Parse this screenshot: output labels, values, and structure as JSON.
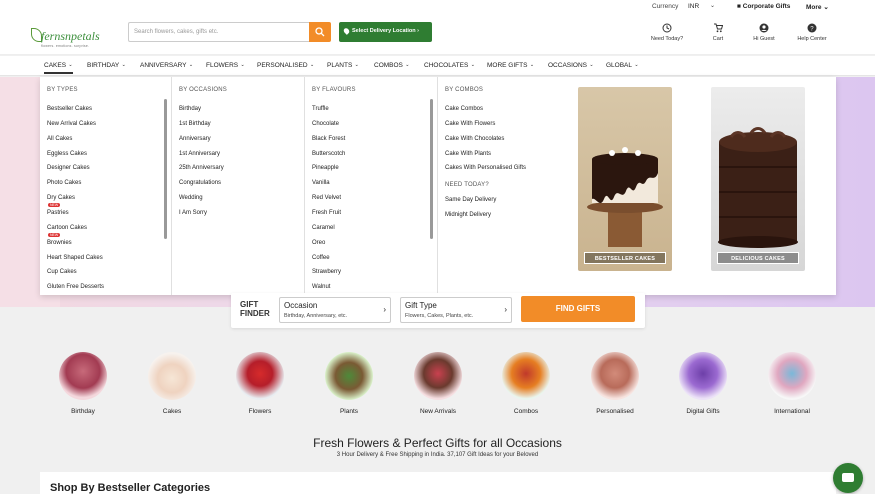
{
  "topbar": {
    "currency_label": "Currency",
    "currency_value": "INR",
    "corporate": "Corporate Gifts",
    "more": "More"
  },
  "header": {
    "logo_name": "fernsnpetals",
    "logo_tagline": "flowers. emotions. surprise.",
    "search_placeholder": "Search flowers, cakes, gifts etc.",
    "delivery_label": "Select Delivery Location",
    "icons": [
      {
        "label": "Need Today?",
        "icon": "clock-icon"
      },
      {
        "label": "Cart",
        "icon": "cart-icon"
      },
      {
        "label": "Hi Guest",
        "icon": "user-icon"
      },
      {
        "label": "Help Center",
        "icon": "help-icon"
      }
    ]
  },
  "nav": {
    "items": [
      "CAKES",
      "BIRTHDAY",
      "ANNIVERSARY",
      "FLOWERS",
      "PERSONALISED",
      "PLANTS",
      "COMBOS",
      "CHOCOLATES",
      "MORE GIFTS",
      "OCCASIONS",
      "GLOBAL"
    ]
  },
  "mega": {
    "types": {
      "heading": "BY TYPES",
      "items": [
        "Bestseller Cakes",
        "New Arrival Cakes",
        "All Cakes",
        "Eggless Cakes",
        "Designer Cakes",
        "Photo Cakes",
        "Dry Cakes",
        "Pastries",
        "Cartoon Cakes",
        "Brownies",
        "Heart Shaped Cakes",
        "Cup Cakes",
        "Gluten Free Desserts"
      ],
      "new_badge": "NEW"
    },
    "occasions": {
      "heading": "BY OCCASIONS",
      "items": [
        "Birthday",
        "1st Birthday",
        "Anniversary",
        "1st Anniversary",
        "25th Anniversary",
        "Congratulations",
        "Wedding",
        "I Am Sorry"
      ]
    },
    "flavours": {
      "heading": "BY FLAVOURS",
      "items": [
        "Truffle",
        "Chocolate",
        "Black Forest",
        "Butterscotch",
        "Pineapple",
        "Vanilla",
        "Red Velvet",
        "Fresh Fruit",
        "Caramel",
        "Oreo",
        "Coffee",
        "Strawberry",
        "Walnut"
      ]
    },
    "combos": {
      "heading": "BY COMBOS",
      "items": [
        "Cake Combos",
        "Cake With Flowers",
        "Cake With Chocolates",
        "Cake With Plants",
        "Cakes With Personalised Gifts"
      ],
      "need_heading": "NEED TODAY?",
      "need_items": [
        "Same Day Delivery",
        "Midnight Delivery"
      ]
    },
    "cards": [
      "BESTSELLER CAKES",
      "DELICIOUS CAKES"
    ]
  },
  "finder": {
    "title_line1": "GIFT",
    "title_line2": "FINDER",
    "occasion_label": "Occasion",
    "occasion_value": "Birthday, Anniversary, etc.",
    "type_label": "Gift Type",
    "type_value": "Flowers, Cakes, Plants, etc.",
    "button": "FIND GIFTS"
  },
  "categories": [
    "Birthday",
    "Cakes",
    "Flowers",
    "Plants",
    "New Arrivals",
    "Combos",
    "Personalised",
    "Digital Gifts",
    "International"
  ],
  "tagline": "Fresh Flowers & Perfect Gifts for all Occasions",
  "subtagline": "3 Hour Delivery & Free Shipping in India. 37,107 Gift Ideas for your Beloved",
  "bestseller_heading": "Shop By Bestseller Categories"
}
